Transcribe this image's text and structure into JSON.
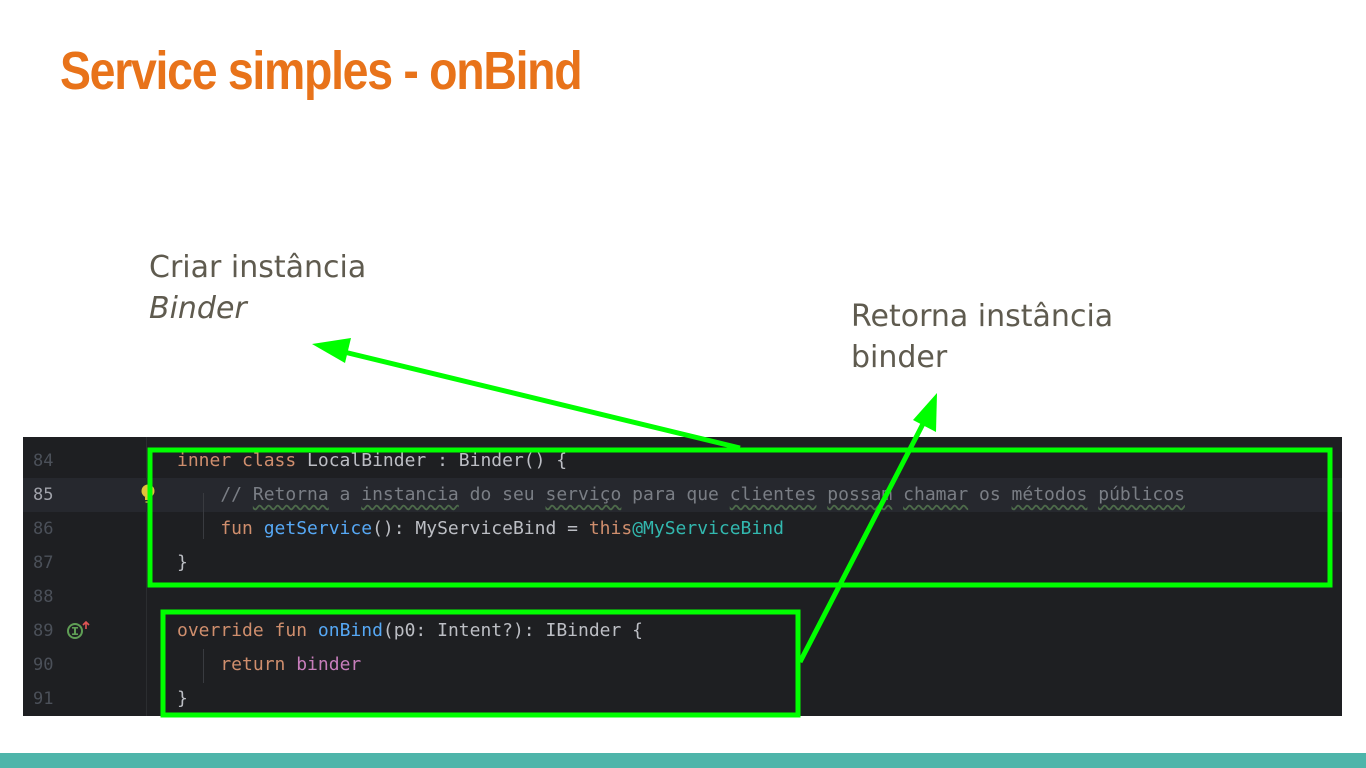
{
  "slide": {
    "title": "Service simples - onBind",
    "label_left": {
      "line1": "Criar instância",
      "line2": "Binder"
    },
    "label_right": {
      "line1": "Retorna instância",
      "line2": "binder"
    }
  },
  "colors": {
    "title": "#e8731a",
    "highlight": "#00ff00",
    "footer": "#4eb5aa",
    "editor_bg": "#1e1f22"
  },
  "code": {
    "lines": [
      {
        "n": "84",
        "tokens": [
          {
            "t": "inner class ",
            "c": "kw"
          },
          {
            "t": "LocalBinder : Binder() {",
            "c": ""
          }
        ]
      },
      {
        "n": "85",
        "current": true,
        "tokens": [
          {
            "t": "    // ",
            "c": "cm"
          },
          {
            "t": "Retorna",
            "c": "cm sq"
          },
          {
            "t": " a ",
            "c": "cm"
          },
          {
            "t": "instancia",
            "c": "cm sq"
          },
          {
            "t": " do seu ",
            "c": "cm"
          },
          {
            "t": "serviço",
            "c": "cm sq"
          },
          {
            "t": " para que ",
            "c": "cm"
          },
          {
            "t": "clientes",
            "c": "cm sq"
          },
          {
            "t": " ",
            "c": "cm"
          },
          {
            "t": "possam",
            "c": "cm sq"
          },
          {
            "t": " ",
            "c": "cm"
          },
          {
            "t": "chamar",
            "c": "cm sq"
          },
          {
            "t": " os ",
            "c": "cm"
          },
          {
            "t": "métodos",
            "c": "cm sq"
          },
          {
            "t": " ",
            "c": "cm"
          },
          {
            "t": "públicos",
            "c": "cm sq"
          }
        ]
      },
      {
        "n": "86",
        "tokens": [
          {
            "t": "    fun ",
            "c": "kw"
          },
          {
            "t": "getService",
            "c": "fn"
          },
          {
            "t": "(): MyServiceBind = ",
            "c": ""
          },
          {
            "t": "this",
            "c": "kw"
          },
          {
            "t": "@MyServiceBind",
            "c": "lbl"
          }
        ]
      },
      {
        "n": "87",
        "tokens": [
          {
            "t": "}",
            "c": ""
          }
        ]
      },
      {
        "n": "88",
        "tokens": []
      },
      {
        "n": "89",
        "tokens": [
          {
            "t": "override fun ",
            "c": "kw"
          },
          {
            "t": "onBind",
            "c": "fn"
          },
          {
            "t": "(p0: Intent?): IBinder {",
            "c": ""
          }
        ]
      },
      {
        "n": "90",
        "tokens": [
          {
            "t": "    return ",
            "c": "kw"
          },
          {
            "t": "binder",
            "c": "pl"
          }
        ]
      },
      {
        "n": "91",
        "tokens": [
          {
            "t": "}",
            "c": ""
          }
        ]
      }
    ],
    "gutter_icons": [
      {
        "line": "85",
        "icon": "lightbulb-icon"
      },
      {
        "line": "89",
        "icon": "implementation-marker-icon"
      }
    ]
  }
}
